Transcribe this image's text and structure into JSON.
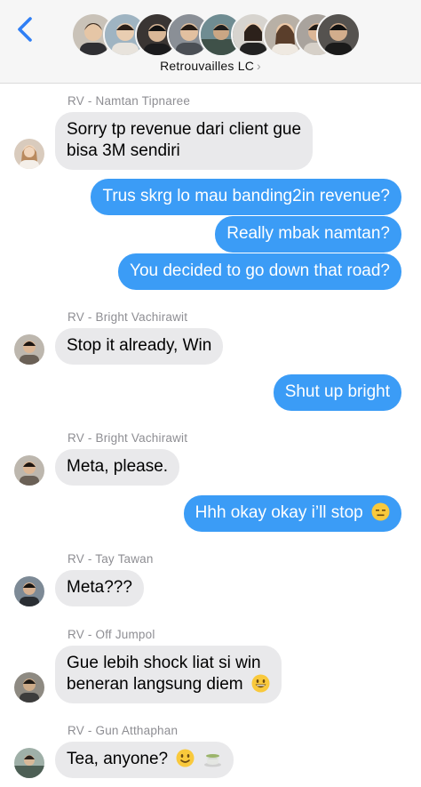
{
  "header": {
    "group_name": "Retrouvailles LC",
    "chevron": "›",
    "back_icon": "chevron-left-icon",
    "accent_color": "#2f7ff5"
  },
  "colors": {
    "incoming_bubble": "#e9e9eb",
    "outgoing_bubble": "#3b9cf6",
    "sender_text": "#8e8e93"
  },
  "messages": [
    {
      "sender": "RV - Namtan Tipnaree",
      "lines": [
        "Sorry tp revenue dari client gue",
        "bisa 3M sendiri"
      ]
    },
    {
      "out1": "Trus skrg lo mau banding2in revenue?",
      "out2": "Really mbak namtan?",
      "out3": "You decided to go down that road?"
    },
    {
      "sender": "RV - Bright Vachirawit",
      "text": "Stop it already, Win"
    },
    {
      "out": "Shut up bright"
    },
    {
      "sender": "RV - Bright Vachirawit",
      "text": "Meta, please."
    },
    {
      "out": "Hhh okay okay i’ll stop",
      "emoji": "expressionless-face-emoji"
    },
    {
      "sender": "RV - Tay Tawan",
      "text": "Meta???"
    },
    {
      "sender": "RV - Off Jumpol",
      "lines": [
        "Gue lebih shock liat si win",
        "beneran langsung diem"
      ],
      "emoji": "grinning-face-emoji"
    },
    {
      "sender": "RV - Gun Atthaphan",
      "text": "Tea, anyone?",
      "emoji": [
        "slightly-smiling-face-emoji",
        "teacup-emoji"
      ]
    }
  ]
}
